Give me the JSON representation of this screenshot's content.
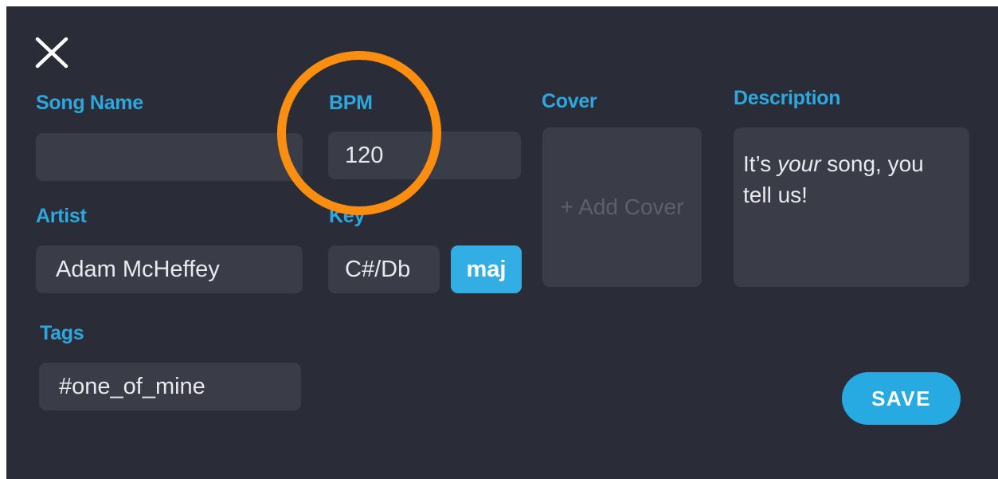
{
  "form": {
    "close_icon": "close-icon",
    "song_name": {
      "label": "Song Name",
      "value": ""
    },
    "bpm": {
      "label": "BPM",
      "value": "120"
    },
    "cover": {
      "label": "Cover",
      "placeholder": "+ Add Cover"
    },
    "description": {
      "label": "Description",
      "value_pre": "It’s ",
      "value_em": "your",
      "value_post": " song, you tell us!"
    },
    "artist": {
      "label": "Artist",
      "value": "Adam McHeffey"
    },
    "key": {
      "label": "Key",
      "value": "C#/Db",
      "mode": "maj"
    },
    "tags": {
      "label": "Tags",
      "value": "#one_of_mine"
    },
    "save_label": "SAVE"
  },
  "colors": {
    "background": "#2a2c38",
    "field": "#3a3c48",
    "accent": "#2ea6de",
    "highlight_ring": "#fa8e10"
  }
}
